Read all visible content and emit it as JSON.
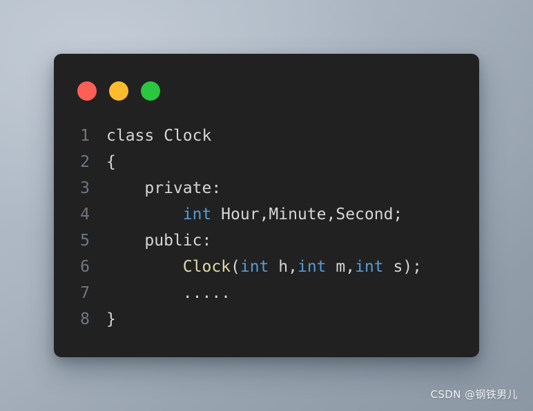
{
  "background": {
    "color_top_left": "#b3bdc8",
    "color_bottom_right": "#8b97a3"
  },
  "card": {
    "background_color": "#212121",
    "window_controls": [
      {
        "name": "close",
        "color": "#fc5f55"
      },
      {
        "name": "minimize",
        "color": "#fdbc2e"
      },
      {
        "name": "maximize",
        "color": "#28c840"
      }
    ]
  },
  "editor": {
    "language": "C++",
    "colors": {
      "default_text": "#d6d6d6",
      "keyword": "#569cd6",
      "function": "#dcdcaa",
      "line_number": "#707880"
    },
    "lines": [
      {
        "number": "1",
        "text": "class Clock",
        "tokens": [
          {
            "text": "class Clock",
            "type": "default"
          }
        ]
      },
      {
        "number": "2",
        "text": "{",
        "tokens": [
          {
            "text": "{",
            "type": "default"
          }
        ]
      },
      {
        "number": "3",
        "text": "    private:",
        "tokens": [
          {
            "text": "    private:",
            "type": "default"
          }
        ]
      },
      {
        "number": "4",
        "text": "        int Hour,Minute,Second;",
        "tokens": [
          {
            "text": "        ",
            "type": "default"
          },
          {
            "text": "int",
            "type": "keyword"
          },
          {
            "text": " Hour,Minute,Second;",
            "type": "default"
          }
        ]
      },
      {
        "number": "5",
        "text": "    public:",
        "tokens": [
          {
            "text": "    public:",
            "type": "default"
          }
        ]
      },
      {
        "number": "6",
        "text": "        Clock(int h,int m,int s);",
        "tokens": [
          {
            "text": "        ",
            "type": "default"
          },
          {
            "text": "Clock",
            "type": "function"
          },
          {
            "text": "(",
            "type": "default"
          },
          {
            "text": "int",
            "type": "keyword"
          },
          {
            "text": " h,",
            "type": "default"
          },
          {
            "text": "int",
            "type": "keyword"
          },
          {
            "text": " m,",
            "type": "default"
          },
          {
            "text": "int",
            "type": "keyword"
          },
          {
            "text": " s);",
            "type": "default"
          }
        ]
      },
      {
        "number": "7",
        "text": "        .....",
        "tokens": [
          {
            "text": "        .....",
            "type": "default"
          }
        ]
      },
      {
        "number": "8",
        "text": "}",
        "tokens": [
          {
            "text": "}",
            "type": "default"
          }
        ]
      }
    ]
  },
  "watermark": {
    "text": "CSDN @钢铁男儿"
  }
}
